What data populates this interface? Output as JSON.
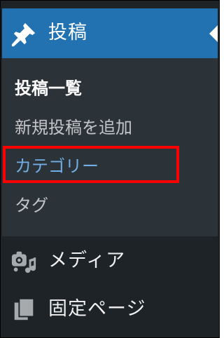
{
  "sidebar": {
    "active_menu": {
      "label": "投稿",
      "icon": "pushpin-icon"
    },
    "submenu": [
      {
        "label": "投稿一覧",
        "state": "current"
      },
      {
        "label": "新規投稿を追加",
        "state": "normal"
      },
      {
        "label": "カテゴリー",
        "state": "hover"
      },
      {
        "label": "タグ",
        "state": "normal"
      }
    ],
    "menu_items": [
      {
        "label": "メディア",
        "icon": "media-icon"
      },
      {
        "label": "固定ページ",
        "icon": "page-icon"
      }
    ]
  },
  "colors": {
    "sidebar_bg": "#1d2327",
    "submenu_bg": "#2c3338",
    "active_bg": "#2271b1",
    "hover_text": "#72aee6",
    "highlight_border": "#ff0000"
  }
}
